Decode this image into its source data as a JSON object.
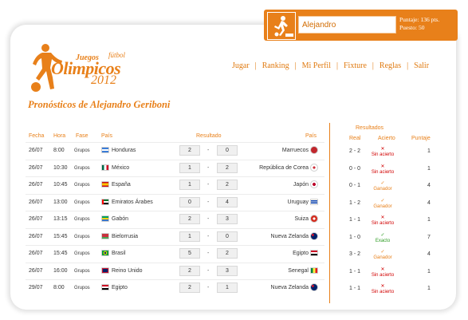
{
  "user": {
    "name": "Alejandro",
    "puntaje": "Puntaje: 136 pts.",
    "puesto": "Puesto: 50"
  },
  "logo": {
    "juegos": "Juegos",
    "futbol": "fútbol",
    "olimpicos": "Olimpicos",
    "year": "2012"
  },
  "nav": [
    "Jugar",
    "Ranking",
    "Mi Perfil",
    "Fixture",
    "Reglas",
    "Salir"
  ],
  "page_title": "Pronósticos de Alejandro Geriboni",
  "table": {
    "headers": {
      "fecha": "Fecha",
      "hora": "Hora",
      "fase": "Fase",
      "pais1": "País",
      "resultado": "Resultado",
      "pais2": "País"
    },
    "rows": [
      {
        "fecha": "26/07",
        "hora": "8:00",
        "fase": "Grupos",
        "home": "Honduras",
        "home_flag": "honduras",
        "s1": "2",
        "s2": "0",
        "away": "Marruecos",
        "away_flag": "marruecos"
      },
      {
        "fecha": "26/07",
        "hora": "10:30",
        "fase": "Grupos",
        "home": "México",
        "home_flag": "mexico",
        "s1": "1",
        "s2": "2",
        "away": "República de Corea",
        "away_flag": "corea"
      },
      {
        "fecha": "26/07",
        "hora": "10:45",
        "fase": "Grupos",
        "home": "España",
        "home_flag": "espana",
        "s1": "1",
        "s2": "2",
        "away": "Japón",
        "away_flag": "japon"
      },
      {
        "fecha": "26/07",
        "hora": "13:00",
        "fase": "Grupos",
        "home": "Emiratos Árabes",
        "home_flag": "emiratos",
        "s1": "0",
        "s2": "4",
        "away": "Uruguay",
        "away_flag": "uruguay"
      },
      {
        "fecha": "26/07",
        "hora": "13:15",
        "fase": "Grupos",
        "home": "Gabón",
        "home_flag": "gabon",
        "s1": "2",
        "s2": "3",
        "away": "Suiza",
        "away_flag": "suiza"
      },
      {
        "fecha": "26/07",
        "hora": "15:45",
        "fase": "Grupos",
        "home": "Bielorrusia",
        "home_flag": "bielorrusia",
        "s1": "1",
        "s2": "0",
        "away": "Nueva Zelanda",
        "away_flag": "nz"
      },
      {
        "fecha": "26/07",
        "hora": "15:45",
        "fase": "Grupos",
        "home": "Brasil",
        "home_flag": "brasil",
        "s1": "5",
        "s2": "2",
        "away": "Egipto",
        "away_flag": "egipto"
      },
      {
        "fecha": "26/07",
        "hora": "16:00",
        "fase": "Grupos",
        "home": "Reino Unido",
        "home_flag": "uk",
        "s1": "2",
        "s2": "3",
        "away": "Senegal",
        "away_flag": "senegal"
      },
      {
        "fecha": "29/07",
        "hora": "8:00",
        "fase": "Grupos",
        "home": "Egipto",
        "home_flag": "egipto",
        "s1": "2",
        "s2": "1",
        "away": "Nueva Zelanda",
        "away_flag": "nz"
      }
    ]
  },
  "results": {
    "title": "Resultados",
    "headers": {
      "real": "Real",
      "acierto": "Acierto",
      "puntaje": "Puntaje"
    },
    "rows": [
      {
        "real": "2 - 2",
        "acierto": "Sin acierto",
        "type": "miss",
        "puntaje": "1"
      },
      {
        "real": "0 - 0",
        "acierto": "Sin acierto",
        "type": "miss",
        "puntaje": "1"
      },
      {
        "real": "0 - 1",
        "acierto": "Ganador",
        "type": "win",
        "puntaje": "4"
      },
      {
        "real": "1 - 2",
        "acierto": "Ganador",
        "type": "win",
        "puntaje": "4"
      },
      {
        "real": "1 - 1",
        "acierto": "Sin acierto",
        "type": "miss",
        "puntaje": "1"
      },
      {
        "real": "1 - 0",
        "acierto": "Exacto",
        "type": "exact",
        "puntaje": "7"
      },
      {
        "real": "3 - 2",
        "acierto": "Ganador",
        "type": "win",
        "puntaje": "4"
      },
      {
        "real": "1 - 1",
        "acierto": "Sin acierto",
        "type": "miss",
        "puntaje": "1"
      },
      {
        "real": "1 - 1",
        "acierto": "Sin acierto",
        "type": "miss",
        "puntaje": "1"
      }
    ]
  },
  "colors": {
    "accent": "#e8801a",
    "miss": "#d10000",
    "exact": "#2c9b22"
  }
}
